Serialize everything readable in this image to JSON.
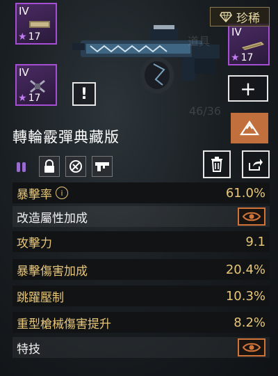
{
  "rarity": {
    "label": "珍稀",
    "icon": "diamond-icon"
  },
  "mods": [
    {
      "tier": "IV",
      "level": "17",
      "icon": "magazine-mod-icon"
    },
    {
      "tier": "IV",
      "level": "17",
      "icon": "crossed-mod-icon"
    },
    {
      "tier": "IV",
      "level": "17",
      "icon": "barrel-mod-icon"
    }
  ],
  "alert": {
    "label": "!"
  },
  "add_button": {
    "label": "+"
  },
  "weapon": {
    "name": "轉輪霰彈典藏版"
  },
  "actions": {
    "orange_icon": "upgrade-icon",
    "delete_icon": "trash-icon",
    "share_icon": "share-icon"
  },
  "attribute_icons": [
    "ammo-icon",
    "lock-icon",
    "no-repair-icon",
    "gun-type-icon"
  ],
  "stats": [
    {
      "label": "暴擊率",
      "value": "61.0%",
      "info": "i"
    },
    {
      "label": "改造屬性加成",
      "value": null,
      "icon": "eye-icon"
    },
    {
      "label": "攻擊力",
      "value": "9.1"
    },
    {
      "label": "暴擊傷害加成",
      "value": "20.4%"
    },
    {
      "label": "跳躍壓制",
      "value": "10.3%"
    },
    {
      "label": "重型槍械傷害提升",
      "value": "8.2%"
    },
    {
      "label": "特技",
      "value": null,
      "icon": "eye-icon"
    }
  ],
  "colors": {
    "accent": "#c1703d",
    "gold": "#e8c77a",
    "mod_border": "#a64fd4"
  }
}
